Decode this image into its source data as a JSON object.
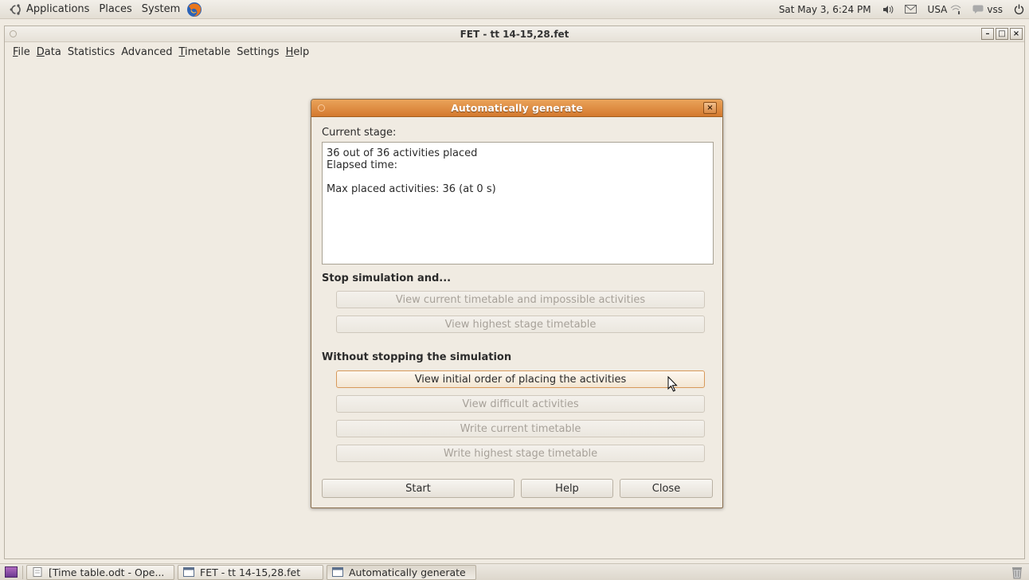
{
  "top_panel": {
    "menus": [
      "Applications",
      "Places",
      "System"
    ],
    "clock": "Sat May 3, 6:24 PM",
    "keyboard_layout": "USA",
    "user": "vss",
    "icons": [
      "ubuntu-logo-icon",
      "firefox-icon",
      "volume-icon",
      "mail-icon",
      "network-icon",
      "chat-icon",
      "power-icon"
    ]
  },
  "main_window": {
    "title": "FET - tt 14-15,28.fet",
    "controls": {
      "minimize": "–",
      "maximize": "□",
      "close": "×"
    },
    "menubar": [
      {
        "label": "File",
        "mnemonic": "F",
        "rest": "ile"
      },
      {
        "label": "Data",
        "mnemonic": "D",
        "rest": "ata"
      },
      {
        "label": "Statistics",
        "mnemonic": "",
        "rest": "Statistics"
      },
      {
        "label": "Advanced",
        "mnemonic": "",
        "rest": "Advanced"
      },
      {
        "label": "Timetable",
        "mnemonic": "T",
        "rest": "imetable"
      },
      {
        "label": "Settings",
        "mnemonic": "",
        "rest": "Settings"
      },
      {
        "label": "Help",
        "mnemonic": "H",
        "rest": "elp"
      }
    ]
  },
  "dialog": {
    "title": "Automatically generate",
    "close_glyph": "×",
    "current_stage_label": "Current stage:",
    "stage_lines": [
      "36 out of 36 activities placed",
      "Elapsed time:",
      "",
      "Max placed activities: 36 (at 0 s)"
    ],
    "stop_section_label": "Stop simulation and...",
    "stop_buttons": [
      {
        "label": "View current timetable and impossible activities",
        "enabled": false
      },
      {
        "label": "View highest stage timetable",
        "enabled": false
      }
    ],
    "continue_section_label": "Without stopping the simulation",
    "continue_buttons": [
      {
        "label": "View initial order of placing the activities",
        "enabled": true
      },
      {
        "label": "View difficult activities",
        "enabled": false
      },
      {
        "label": "Write current timetable",
        "enabled": false
      },
      {
        "label": "Write highest stage timetable",
        "enabled": false
      }
    ],
    "footer_buttons": {
      "start": "Start",
      "help": "Help",
      "close": "Close"
    }
  },
  "taskbar": {
    "tasks": [
      {
        "label": "[Time table.odt - Ope...",
        "icon": "document-icon",
        "active": false
      },
      {
        "label": "FET - tt 14-15,28.fet",
        "icon": "window-icon",
        "active": false
      },
      {
        "label": "Automatically generate",
        "icon": "window-icon",
        "active": true
      }
    ]
  }
}
